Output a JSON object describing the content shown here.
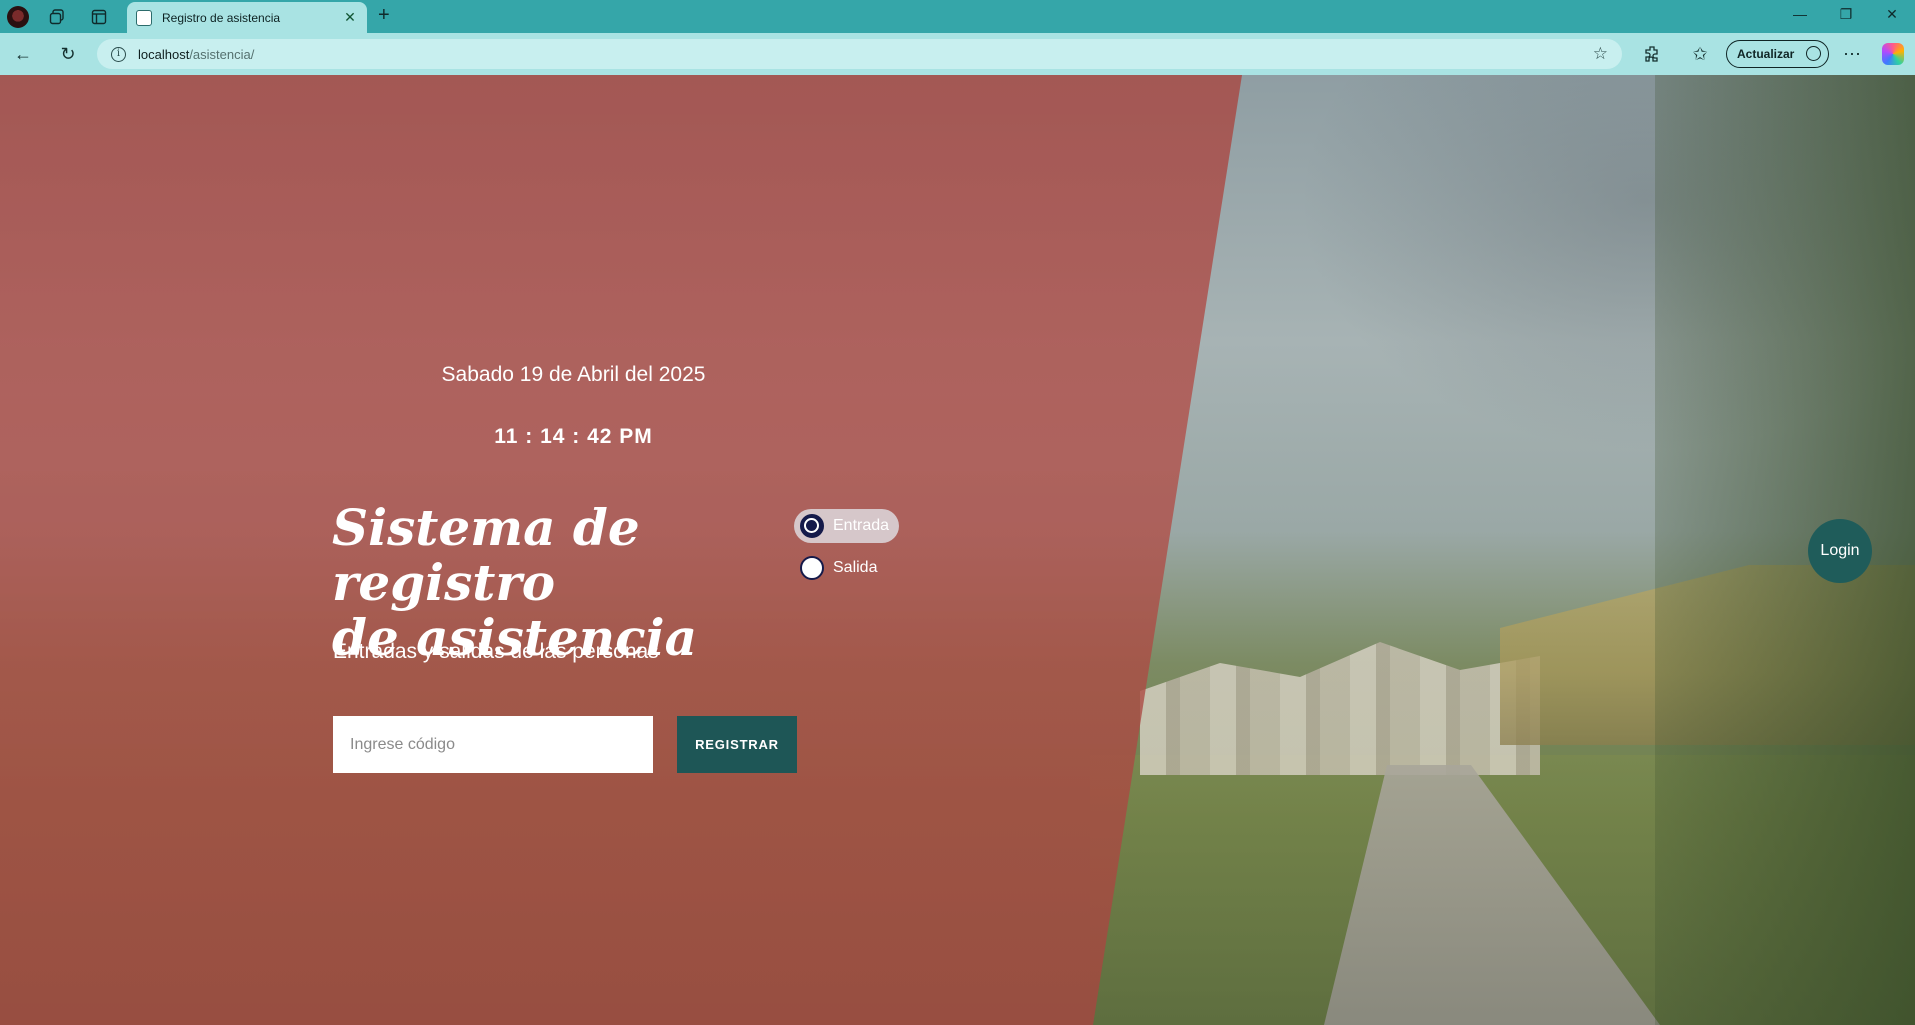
{
  "browser": {
    "tab_title": "Registro de asistencia",
    "url_host": "localhost",
    "url_path": "/asistencia/",
    "update_label": "Actualizar"
  },
  "page": {
    "date_text": "Sabado 19 de Abril del 2025",
    "clock_text": "11 : 14 : 42 PM",
    "title_line1": "Sistema de registro",
    "title_line2": "de asistencia",
    "subtitle": "Entradas y salidas de las personas",
    "radio_options": [
      {
        "label": "Entrada",
        "checked": true
      },
      {
        "label": "Salida",
        "checked": false
      }
    ],
    "code_input": {
      "placeholder": "Ingrese código",
      "value": ""
    },
    "register_label": "REGISTRAR",
    "login_label": "Login"
  },
  "colors": {
    "overlay": "#b24e48",
    "button_teal": "#1e5656",
    "browser_accent": "#35a6a9",
    "radio_navy": "#151a4a"
  }
}
